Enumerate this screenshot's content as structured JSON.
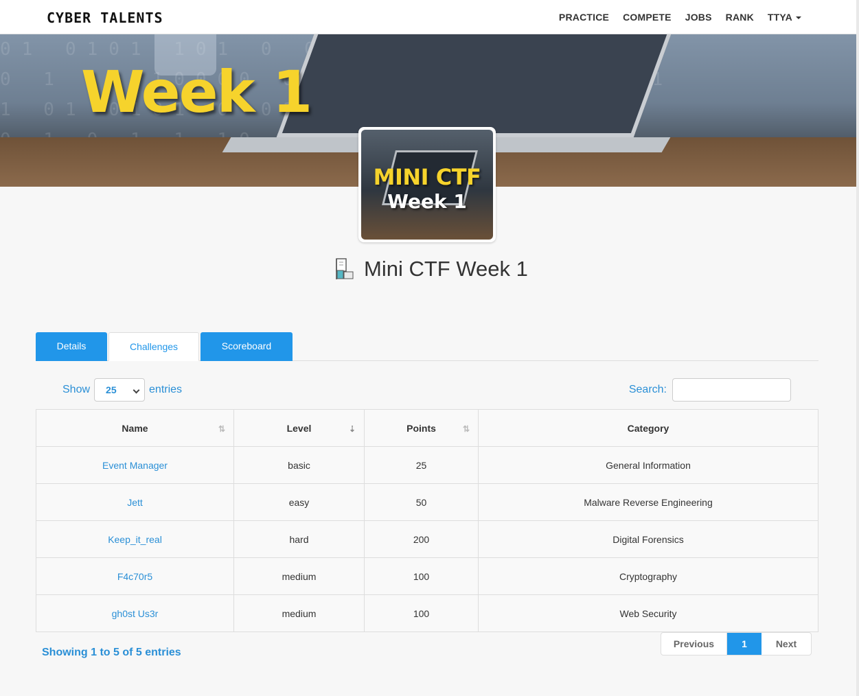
{
  "navbar": {
    "brand": "CYBER TALENTS",
    "items": [
      "PRACTICE",
      "COMPETE",
      "JOBS",
      "RANK"
    ],
    "user": "TTYA"
  },
  "hero": {
    "title": "Week 1"
  },
  "thumbnail": {
    "line1": "MINI CTF",
    "line2": "Week 1"
  },
  "page": {
    "title": "Mini CTF Week 1"
  },
  "tabs": [
    {
      "label": "Details",
      "active": false
    },
    {
      "label": "Challenges",
      "active": true
    },
    {
      "label": "Scoreboard",
      "active": false
    }
  ],
  "controls": {
    "show_label": "Show",
    "entries_value": "25",
    "entries_label": "entries",
    "search_label": "Search:",
    "search_value": ""
  },
  "table": {
    "headers": [
      "Name",
      "Level",
      "Points",
      "Category"
    ],
    "rows": [
      {
        "name": "Event Manager",
        "level": "basic",
        "points": "25",
        "category": "General Information"
      },
      {
        "name": "Jett",
        "level": "easy",
        "points": "50",
        "category": "Malware Reverse Engineering"
      },
      {
        "name": "Keep_it_real",
        "level": "hard",
        "points": "200",
        "category": "Digital Forensics"
      },
      {
        "name": "F4c70r5",
        "level": "medium",
        "points": "100",
        "category": "Cryptography"
      },
      {
        "name": "gh0st Us3r",
        "level": "medium",
        "points": "100",
        "category": "Web Security"
      }
    ]
  },
  "footer": {
    "info": "Showing 1 to 5 of 5 entries",
    "prev": "Previous",
    "current_page": "1",
    "next": "Next"
  },
  "colors": {
    "accent": "#2196e9",
    "link": "#2a8fd6",
    "hero_title": "#f6d32c"
  }
}
